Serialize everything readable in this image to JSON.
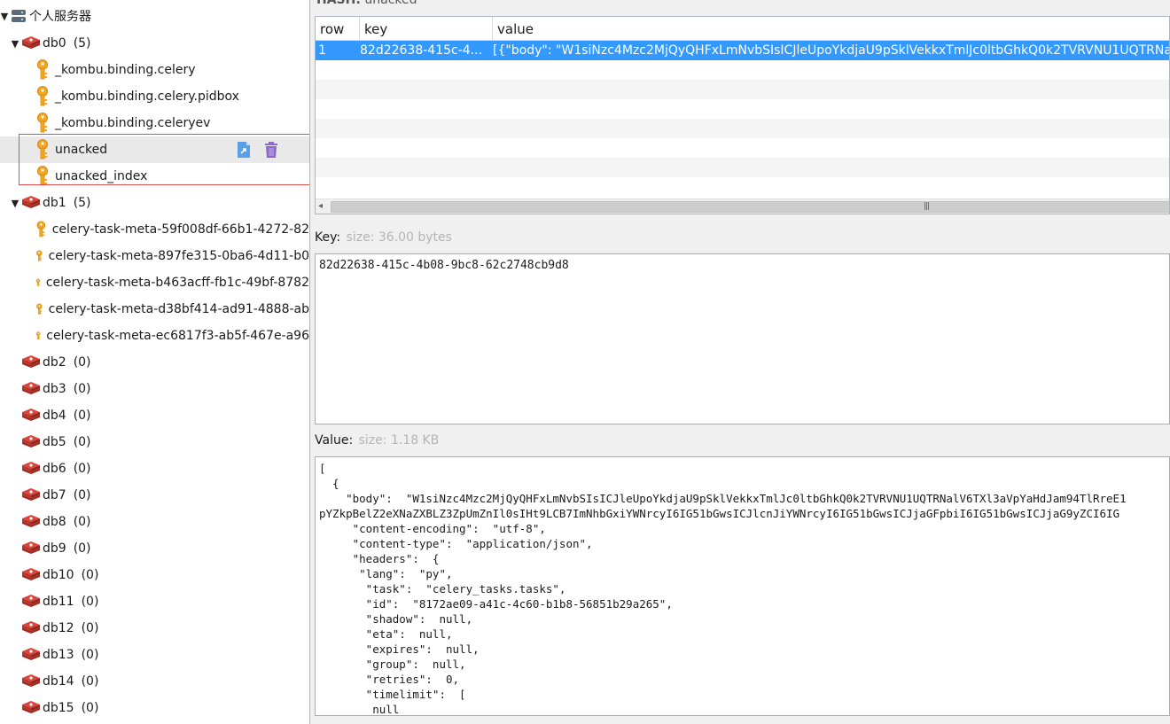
{
  "tree": {
    "server_name": "个人服务器",
    "items": [
      {
        "label": "db0",
        "count": "(5)",
        "expanded": true
      },
      {
        "label": "_kombu.binding.celery"
      },
      {
        "label": "_kombu.binding.celery.pidbox"
      },
      {
        "label": "_kombu.binding.celeryev"
      },
      {
        "label": "unacked"
      },
      {
        "label": "unacked_index"
      },
      {
        "label": "db1",
        "count": "(5)",
        "expanded": true
      },
      {
        "label": "celery-task-meta-59f008df-66b1-4272-82"
      },
      {
        "label": "celery-task-meta-897fe315-0ba6-4d11-b0"
      },
      {
        "label": "celery-task-meta-b463acff-fb1c-49bf-8782"
      },
      {
        "label": "celery-task-meta-d38bf414-ad91-4888-ab"
      },
      {
        "label": "celery-task-meta-ec6817f3-ab5f-467e-a96"
      },
      {
        "label": "db2",
        "count": "(0)"
      },
      {
        "label": "db3",
        "count": "(0)"
      },
      {
        "label": "db4",
        "count": "(0)"
      },
      {
        "label": "db5",
        "count": "(0)"
      },
      {
        "label": "db6",
        "count": "(0)"
      },
      {
        "label": "db7",
        "count": "(0)"
      },
      {
        "label": "db8",
        "count": "(0)"
      },
      {
        "label": "db9",
        "count": "(0)"
      },
      {
        "label": "db10",
        "count": "(0)"
      },
      {
        "label": "db11",
        "count": "(0)"
      },
      {
        "label": "db12",
        "count": "(0)"
      },
      {
        "label": "db13",
        "count": "(0)"
      },
      {
        "label": "db14",
        "count": "(0)"
      },
      {
        "label": "db15",
        "count": "(0)"
      }
    ]
  },
  "header": {
    "type_label": "HASH:",
    "key_name": "unacked"
  },
  "table": {
    "columns": [
      "row",
      "key",
      "value"
    ],
    "rows": [
      {
        "row": "1",
        "key": "82d22638-415c-4...",
        "value": "[{\"body\": \"W1siNzc4Mzc2MjQyQHFxLmNvbSIsICJleUpoYkdjaU9pSklVekkxTmlJc0ltbGhkQ0k2TVRVNU1UQTRNa"
      }
    ]
  },
  "key_section": {
    "label": "Key:",
    "meta": "size: 36.00 bytes",
    "value": "82d22638-415c-4b08-9bc8-62c2748cb9d8"
  },
  "value_section": {
    "label": "Value:",
    "meta": "size: 1.18 KB",
    "text": "[\n  {\n    \"body\":  \"W1siNzc4Mzc2MjQyQHFxLmNvbSIsICJleUpoYkdjaU9pSklVekkxTmlJc0ltbGhkQ0k2TVRVNU1UQTRNalV6TXl3aVpYaHdJam94TlRreE1\npYZkpBelZ2eXNaZXBLZ3ZpUmZnIl0sIHt9LCB7ImNhbGxiYWNrcyI6IG51bGwsICJlcnJiYWNrcyI6IG51bGwsICJjaGFpbiI6IG51bGwsICJjaG9yZCI6IG\n     \"content-encoding\":  \"utf-8\",\n     \"content-type\":  \"application/json\",\n     \"headers\":  {\n      \"lang\":  \"py\",\n       \"task\":  \"celery_tasks.tasks\",\n       \"id\":  \"8172ae09-a41c-4c60-b1b8-56851b29a265\",\n       \"shadow\":  null,\n       \"eta\":  null,\n       \"expires\":  null,\n       \"group\":  null,\n       \"retries\":  0,\n       \"timelimit\":  [\n        null"
  },
  "colors": {
    "selection": "#3399ff",
    "highlight_box": "#e05050",
    "key_icon": "#f5a623",
    "redis_icon": "#c8302a"
  }
}
